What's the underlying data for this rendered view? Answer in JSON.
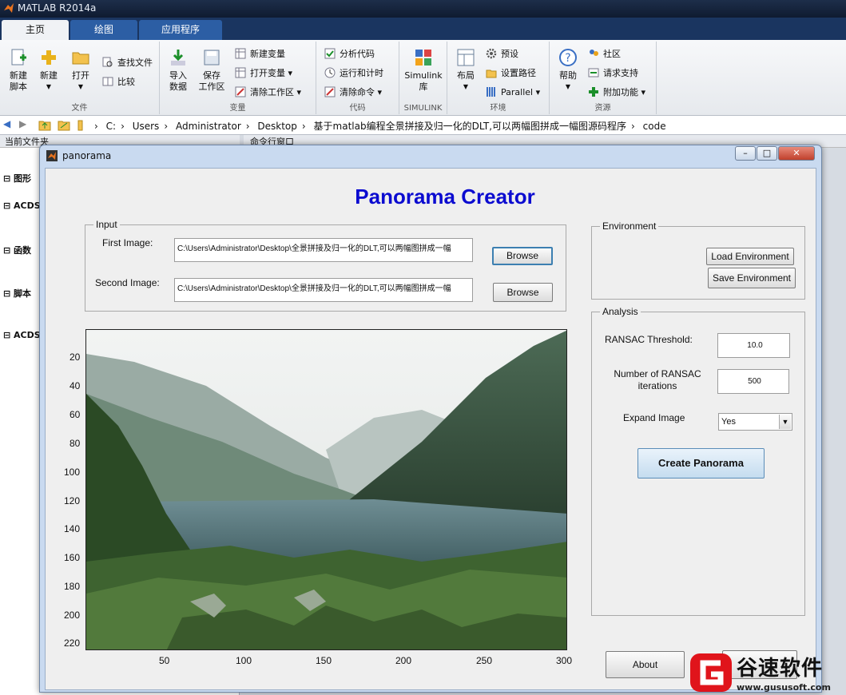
{
  "app": {
    "title": "MATLAB R2014a"
  },
  "tabs": [
    {
      "label": "主页"
    },
    {
      "label": "绘图"
    },
    {
      "label": "应用程序"
    }
  ],
  "ribbon": {
    "file": {
      "group_label": "文件",
      "new_script": "新建\n脚本",
      "new": "新建",
      "open": "打开",
      "find_files": "查找文件",
      "compare": "比较"
    },
    "variable": {
      "group_label": "变量",
      "import": "导入\n数据",
      "save_ws": "保存\n工作区",
      "new_var": "新建变量",
      "open_var": "打开变量",
      "clear_ws": "清除工作区"
    },
    "code": {
      "group_label": "代码",
      "analyze": "分析代码",
      "run_time": "运行和计时",
      "clear_cmd": "清除命令"
    },
    "simulink": {
      "group_label": "SIMULINK",
      "library": "Simulink\n库"
    },
    "env": {
      "group_label": "环境",
      "layout": "布局",
      "prefs": "预设",
      "set_path": "设置路径",
      "parallel": "Parallel"
    },
    "resources": {
      "group_label": "资源",
      "help": "帮助",
      "community": "社区",
      "support": "请求支持",
      "addons": "附加功能"
    }
  },
  "address": {
    "crumbs": [
      "C:",
      "Users",
      "Administrator",
      "Desktop",
      "基于matlab编程全景拼接及归一化的DLT,可以两幅图拼成一幅图源码程序",
      "code"
    ]
  },
  "left_panel": {
    "header": "当前文件夹",
    "items": [
      "图形",
      "ACDS",
      "函数",
      "脚本",
      "ACDS"
    ]
  },
  "command_window": {
    "header": "命令行窗口"
  },
  "figure": {
    "title": "panorama",
    "heading": "Panorama Creator",
    "input": {
      "label": "Input",
      "first_label": "First Image:",
      "first_value": "C:\\Users\\Administrator\\Desktop\\全景拼接及归一化的DLT,可以两幅图拼成一幅",
      "second_label": "Second Image:",
      "second_value": "C:\\Users\\Administrator\\Desktop\\全景拼接及归一化的DLT,可以两幅图拼成一幅",
      "browse1": "Browse",
      "browse2": "Browse"
    },
    "environment": {
      "label": "Environment",
      "load": "Load Environment",
      "save": "Save Environment"
    },
    "analysis": {
      "label": "Analysis",
      "ransac_threshold_label": "RANSAC Threshold:",
      "ransac_threshold": "10.0",
      "ransac_iter_label": "Number of RANSAC iterations",
      "ransac_iter": "500",
      "expand_label": "Expand Image",
      "expand_value": "Yes",
      "create": "Create Panorama"
    },
    "about": "About",
    "axes": {
      "y_ticks": [
        "20",
        "40",
        "60",
        "80",
        "100",
        "120",
        "140",
        "160",
        "180",
        "200",
        "220"
      ],
      "x_ticks": [
        "50",
        "100",
        "150",
        "200",
        "250",
        "300"
      ]
    }
  },
  "watermark": {
    "brand": "谷速软件",
    "url": "www.gususoft.com"
  },
  "colors": {
    "heading": "#0b0bd0",
    "accent": "#3c7fb1"
  }
}
